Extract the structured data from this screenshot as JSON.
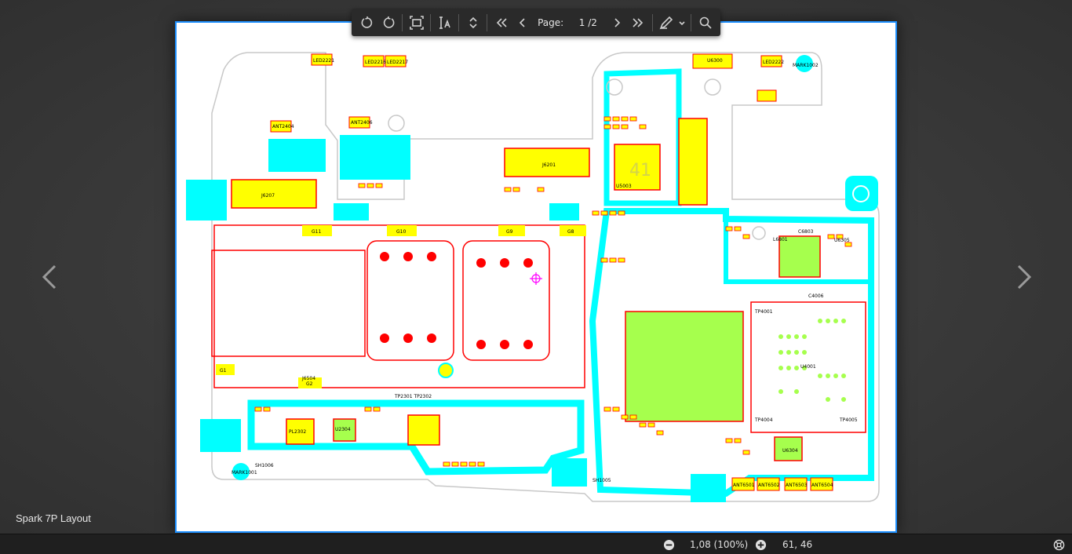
{
  "toolbar": {
    "rotate_left": "rotate-left",
    "rotate_right": "rotate-right",
    "fit_page": "fit-page",
    "text_select": "text-select",
    "scroll_mode": "scroll-mode",
    "first_page": "first-page",
    "prev_page": "previous-page",
    "page_label": "Page:",
    "page_value": "1 /2",
    "next_page": "next-page",
    "last_page": "last-page",
    "annotate": "annotate",
    "search": "search"
  },
  "document": {
    "title": "Spark 7P Layout"
  },
  "statusbar": {
    "zoom": "1,08 (100%)",
    "cursor": "61, 46"
  },
  "board_labels": {
    "j6207": "J6207",
    "j6201": "J6201",
    "u6300": "U6300",
    "u4001": "U4001",
    "u5003": "U5003",
    "l6801": "L6801",
    "led2221": "LED2221",
    "led2216": "LED2216",
    "led2217": "LED2217",
    "led2222": "LED2222",
    "mark1002": "MARK1002",
    "mark1001": "MARK1001",
    "ant6501": "ANT6501",
    "ant6502": "ANT6502",
    "ant6503": "ANT6503",
    "ant6504": "ANT6504",
    "ant2404": "ANT2404",
    "ant2406": "ANT2406",
    "pl2302": "PL2302",
    "u2304": "U2304",
    "tp4001": "TP4001",
    "tp4004": "TP4004",
    "tp4005": "TP4005",
    "tp2301": "TP2301 TP2302",
    "g11": "G11",
    "g10": "G10",
    "g9": "G9",
    "g8": "G8",
    "g2": "G2",
    "g1": "G1",
    "sh1006": "SH1006",
    "sh1005": "SH1005",
    "j6504": "J6504",
    "u6304": "U6304",
    "c4006": "C4006",
    "c6803": "C6803",
    "u6305": "U6305",
    "chip_mark": "41"
  },
  "colors": {
    "accent": "#1e90ff",
    "cyan": "#00ffff",
    "yellow": "#ffff00",
    "red": "#ff0000",
    "green": "#a6ff4d",
    "outline": "#c8c8c8"
  }
}
